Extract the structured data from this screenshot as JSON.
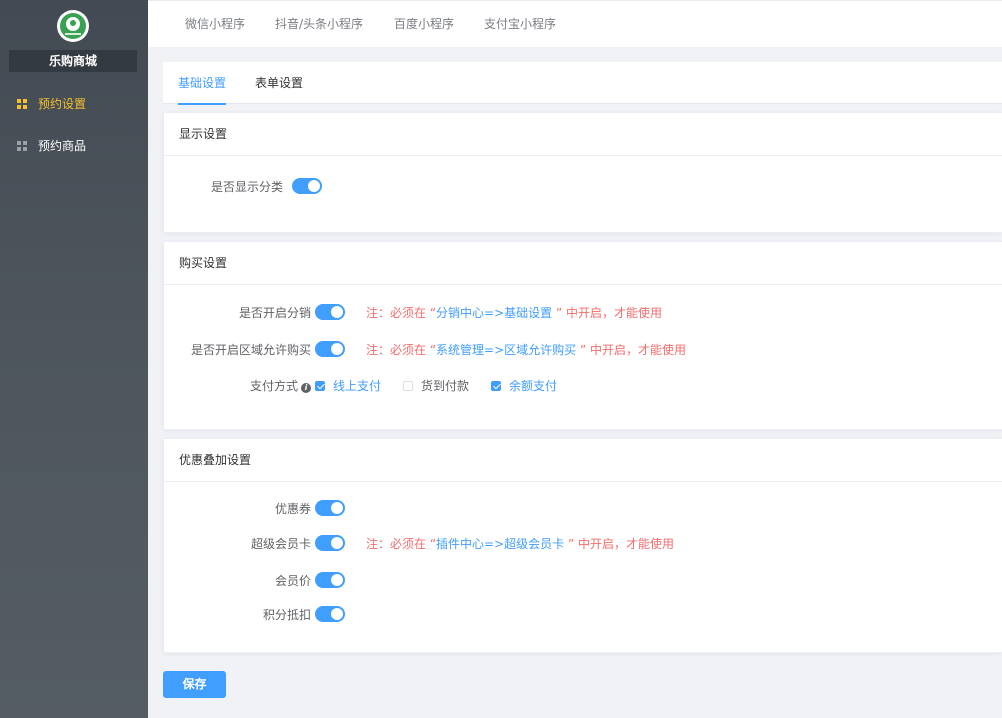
{
  "sidebar": {
    "store_name": "乐购商城",
    "items": [
      {
        "label": "预约设置",
        "active": true
      },
      {
        "label": "预约商品",
        "active": false
      }
    ]
  },
  "topbar": {
    "tabs": [
      "微信小程序",
      "抖音/头条小程序",
      "百度小程序",
      "支付宝小程序"
    ]
  },
  "subtabs": {
    "basic": "基础设置",
    "form": "表单设置",
    "active": "基础设置"
  },
  "display": {
    "title": "显示设置",
    "show_category_label": "是否显示分类",
    "show_category_on": true
  },
  "purchase": {
    "title": "购买设置",
    "share_label": "是否开启分销",
    "share_on": true,
    "share_note_prefix": "注：必须在 “",
    "share_note_link": "分销中心=>基础设置",
    "share_note_suffix": " ” 中开启，才能使用",
    "region_label": "是否开启区域允许购买",
    "region_on": true,
    "region_note_prefix": "注：必须在 “",
    "region_note_link": "系统管理=>区域允许购买",
    "region_note_suffix": " ” 中开启，才能使用",
    "payment_label": "支付方式",
    "payment_options": [
      {
        "label": "线上支付",
        "checked": true
      },
      {
        "label": "货到付款",
        "checked": false
      },
      {
        "label": "余额支付",
        "checked": true
      }
    ]
  },
  "discount": {
    "title": "优惠叠加设置",
    "coupon_label": "优惠券",
    "coupon_on": true,
    "vip_card_label": "超级会员卡",
    "vip_card_on": true,
    "vip_note_prefix": "注：必须在 “",
    "vip_note_link": "插件中心=>超级会员卡",
    "vip_note_suffix": " ” 中开启，才能使用",
    "member_price_label": "会员价",
    "member_price_on": true,
    "points_label": "积分抵扣",
    "points_on": true
  },
  "save_label": "保存",
  "colors": {
    "primary": "#409eff",
    "active_sidebar": "#f5c02e",
    "note_red": "#f56c6c",
    "logo_green": "#3aa152"
  }
}
